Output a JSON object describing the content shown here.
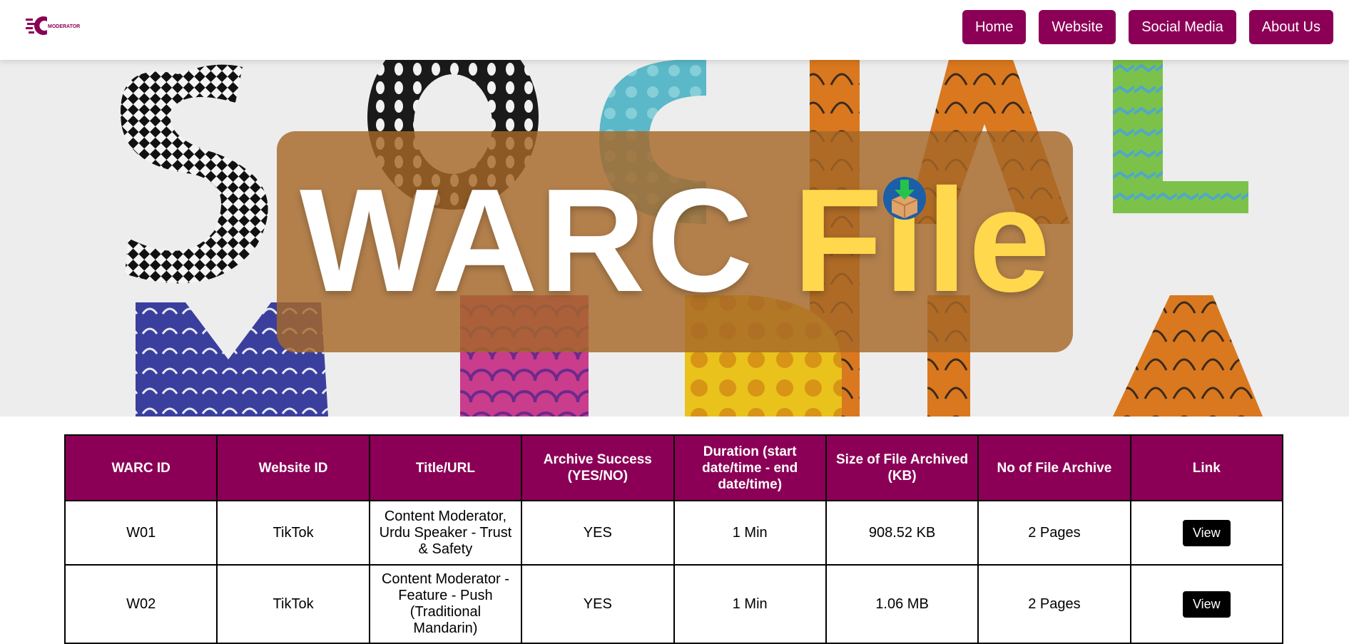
{
  "nav": {
    "logo_text": "MODERATOR",
    "links": [
      "Home",
      "Website",
      "Social Media",
      "About Us"
    ]
  },
  "hero": {
    "title_part1": "WARC",
    "title_part2": "File"
  },
  "table": {
    "headers": [
      "WARC ID",
      "Website ID",
      "Title/URL",
      "Archive Success (YES/NO)",
      "Duration (start date/time - end date/time)",
      "Size of File Archived (KB)",
      "No of File Archive",
      "Link"
    ],
    "rows": [
      [
        "W01",
        "TikTok",
        "Content Moderator, Urdu Speaker - Trust & Safety",
        "YES",
        "1 Min",
        "908.52 KB",
        "2 Pages",
        "View"
      ],
      [
        "W02",
        "TikTok",
        "Content Moderator - Feature - Push (Traditional Mandarin)",
        "YES",
        "1 Min",
        "1.06 MB",
        "2 Pages",
        "View"
      ]
    ]
  },
  "colors": {
    "brand": "#8b0056",
    "title_white": "#ffffff",
    "title_yellow": "#ffd84d",
    "overlay": "#a66828"
  }
}
